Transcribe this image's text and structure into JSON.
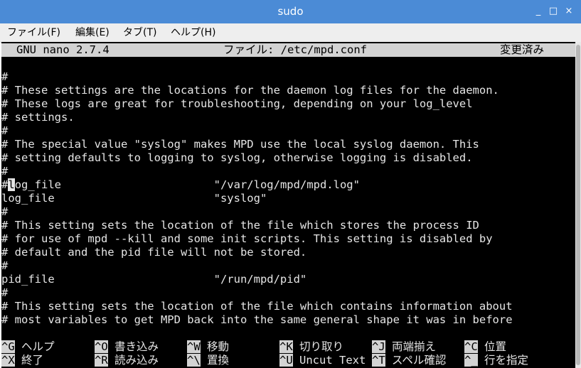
{
  "window": {
    "title": "sudo",
    "minimize": "_",
    "maximize": "□",
    "close": "×"
  },
  "menu": [
    "ファイル(F)",
    "編集(E)",
    "タブ(T)",
    "ヘルプ(H)"
  ],
  "nano": {
    "version": "GNU nano 2.7.4",
    "file": "ファイル: /etc/mpd.conf",
    "status": "変更済み"
  },
  "content": {
    "line_1": "",
    "line_2": "#",
    "line_3": "# These settings are the locations for the daemon log files for the daemon.",
    "line_4": "# These logs are great for troubleshooting, depending on your log_level",
    "line_5": "# settings.",
    "line_6": "#",
    "line_7": "# The special value \"syslog\" makes MPD use the local syslog daemon. This",
    "line_8": "# setting defaults to logging to syslog, otherwise logging is disabled.",
    "line_9": "#",
    "line_10": {
      "before_cursor": "#",
      "cursor_char": "l",
      "after_cursor": "og_file                       \"/var/log/mpd/mpd.log\""
    },
    "line_11": "log_file                        \"syslog\"",
    "line_12": "#",
    "line_13": "# This setting sets the location of the file which stores the process ID",
    "line_14": "# for use of mpd --kill and some init scripts. This setting is disabled by",
    "line_15": "# default and the pid file will not be stored.",
    "line_16": "#",
    "line_17": "pid_file                        \"/run/mpd/pid\"",
    "line_18": "#",
    "line_19": "# This setting sets the location of the file which contains information about",
    "line_20": "# most variables to get MPD back into the same general shape it was in before",
    "line_21": ""
  },
  "shortcuts": {
    "row1": [
      {
        "key": "^G",
        "label": " ヘルプ"
      },
      {
        "key": "^O",
        "label": " 書き込み"
      },
      {
        "key": "^W",
        "label": " 移動"
      },
      {
        "key": "^K",
        "label": " 切り取り"
      },
      {
        "key": "^J",
        "label": " 両端揃え"
      },
      {
        "key": "^C",
        "label": " 位置"
      }
    ],
    "row2": [
      {
        "key": "^X",
        "label": " 終了"
      },
      {
        "key": "^R",
        "label": " 読み込み"
      },
      {
        "key": "^\\",
        "label": " 置換"
      },
      {
        "key": "^U",
        "label": " Uncut Text"
      },
      {
        "key": "^T",
        "label": " スペル確認"
      },
      {
        "key": "^_",
        "label": " 行を指定"
      }
    ]
  }
}
